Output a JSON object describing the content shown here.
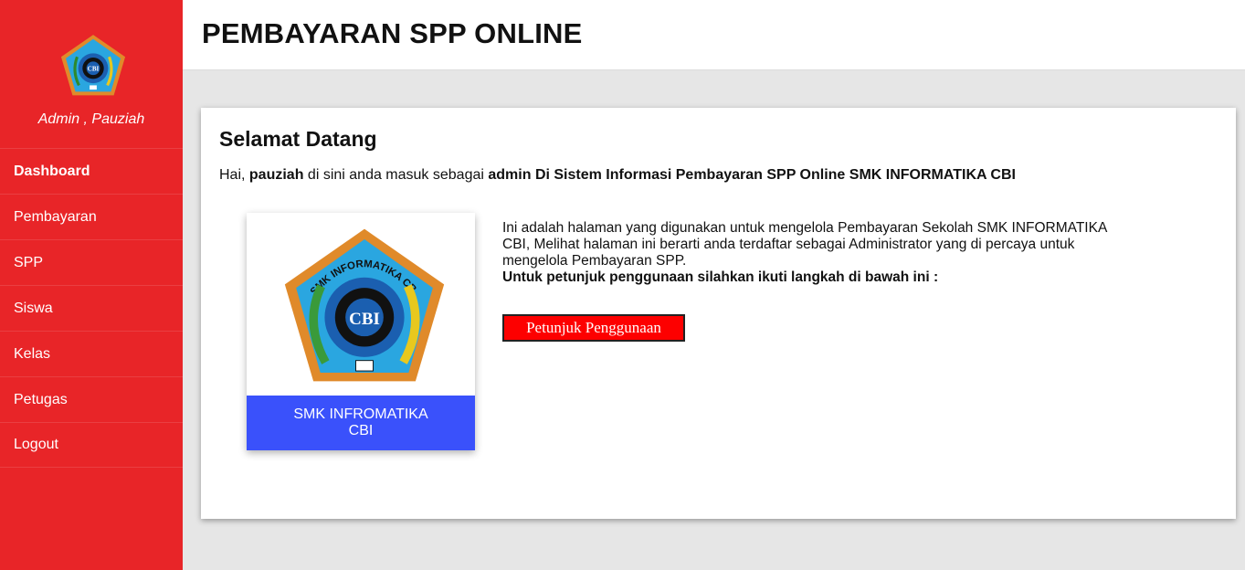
{
  "sidebar": {
    "user_label": "Admin , Pauziah",
    "logo_icon": "school-emblem-icon",
    "items": [
      {
        "label": "Dashboard",
        "active": true
      },
      {
        "label": "Pembayaran"
      },
      {
        "label": "SPP"
      },
      {
        "label": "Siswa"
      },
      {
        "label": "Kelas"
      },
      {
        "label": "Petugas"
      },
      {
        "label": "Logout"
      }
    ]
  },
  "header": {
    "title": "PEMBAYARAN SPP ONLINE"
  },
  "welcome": {
    "heading": "Selamat Datang",
    "greet_prefix": "Hai, ",
    "greet_user": "pauziah",
    "greet_mid": " di sini anda masuk sebagai ",
    "greet_role": "admin Di Sistem Informasi Pembayaran SPP Online SMK INFORMATIKA CBI",
    "school_card_label": "SMK INFROMATIKA CBI",
    "emblem_text": "SMK INFORMATIKA CBI",
    "emblem_center": "CBI",
    "description": "Ini adalah halaman yang digunakan untuk mengelola Pembayaran Sekolah SMK INFORMATIKA CBI, Melihat halaman ini berarti anda terdaftar sebagai Administrator yang di percaya untuk mengelola Pembayaran SPP.",
    "instruction": "Untuk petunjuk penggunaan silahkan ikuti langkah di bawah ini :",
    "button_label": "Petunjuk Penggunaan"
  },
  "colors": {
    "sidebar": "#e82528",
    "accent_blue": "#3a51fb",
    "button": "#fd0000",
    "background": "#e6e6e6"
  }
}
